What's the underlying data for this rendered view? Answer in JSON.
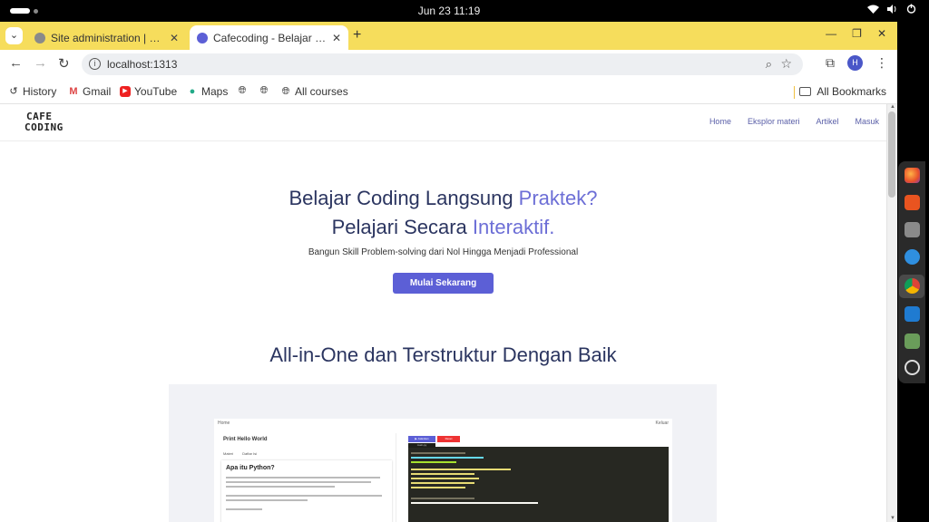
{
  "os": {
    "clock": "Jun 23  11:19"
  },
  "browser": {
    "tabs": [
      {
        "title": "Site administration | Django site admin",
        "favicon_color": "#8a8a8a",
        "active": false
      },
      {
        "title": "Cafecoding - Belajar coding",
        "favicon_color": "#5c5fd6",
        "active": true
      }
    ],
    "new_tab": "+",
    "address": {
      "url": "localhost:1313"
    },
    "profile_initial": "H",
    "bookmarks": [
      {
        "label": "History",
        "icon": "history-icon"
      },
      {
        "label": "Gmail",
        "icon": "gmail-icon"
      },
      {
        "label": "YouTube",
        "icon": "youtube-icon"
      },
      {
        "label": "Maps",
        "icon": "maps-icon"
      },
      {
        "label": "",
        "icon": "globe-icon"
      },
      {
        "label": "",
        "icon": "globe-icon"
      },
      {
        "label": "All courses",
        "icon": "globe-icon"
      }
    ],
    "all_bookmarks": "All Bookmarks"
  },
  "site": {
    "logo_line1": "CAFE",
    "logo_line2": "CODING",
    "nav": [
      "Home",
      "Eksplor materi",
      "Artikel",
      "Masuk"
    ],
    "hero": {
      "line1_plain": "Belajar Coding Langsung ",
      "line1_accent": "Praktek?",
      "line2_plain": "Pelajari Secara ",
      "line2_accent": "Interaktif.",
      "subtitle": "Bangun Skill Problem-solving dari Nol Hingga Menjadi Professional",
      "cta": "Mulai Sekarang"
    },
    "section_title": "All-in-One dan Terstruktur Dengan Baik",
    "preview": {
      "home": "Home",
      "keluar": "Keluar",
      "lesson_title": "Print Hello World",
      "tab_materi": "Materi",
      "tab_daftar": "Daftar Isi",
      "card_title": "Apa itu Python?",
      "run": "▶ Jalankan",
      "reset": "Reset",
      "editor_tab": "main.py"
    }
  },
  "colors": {
    "tabstrip": "#f6dd5c",
    "accent": "#6c6ed6",
    "cta": "#5c5fd6",
    "heading": "#2b3560"
  }
}
